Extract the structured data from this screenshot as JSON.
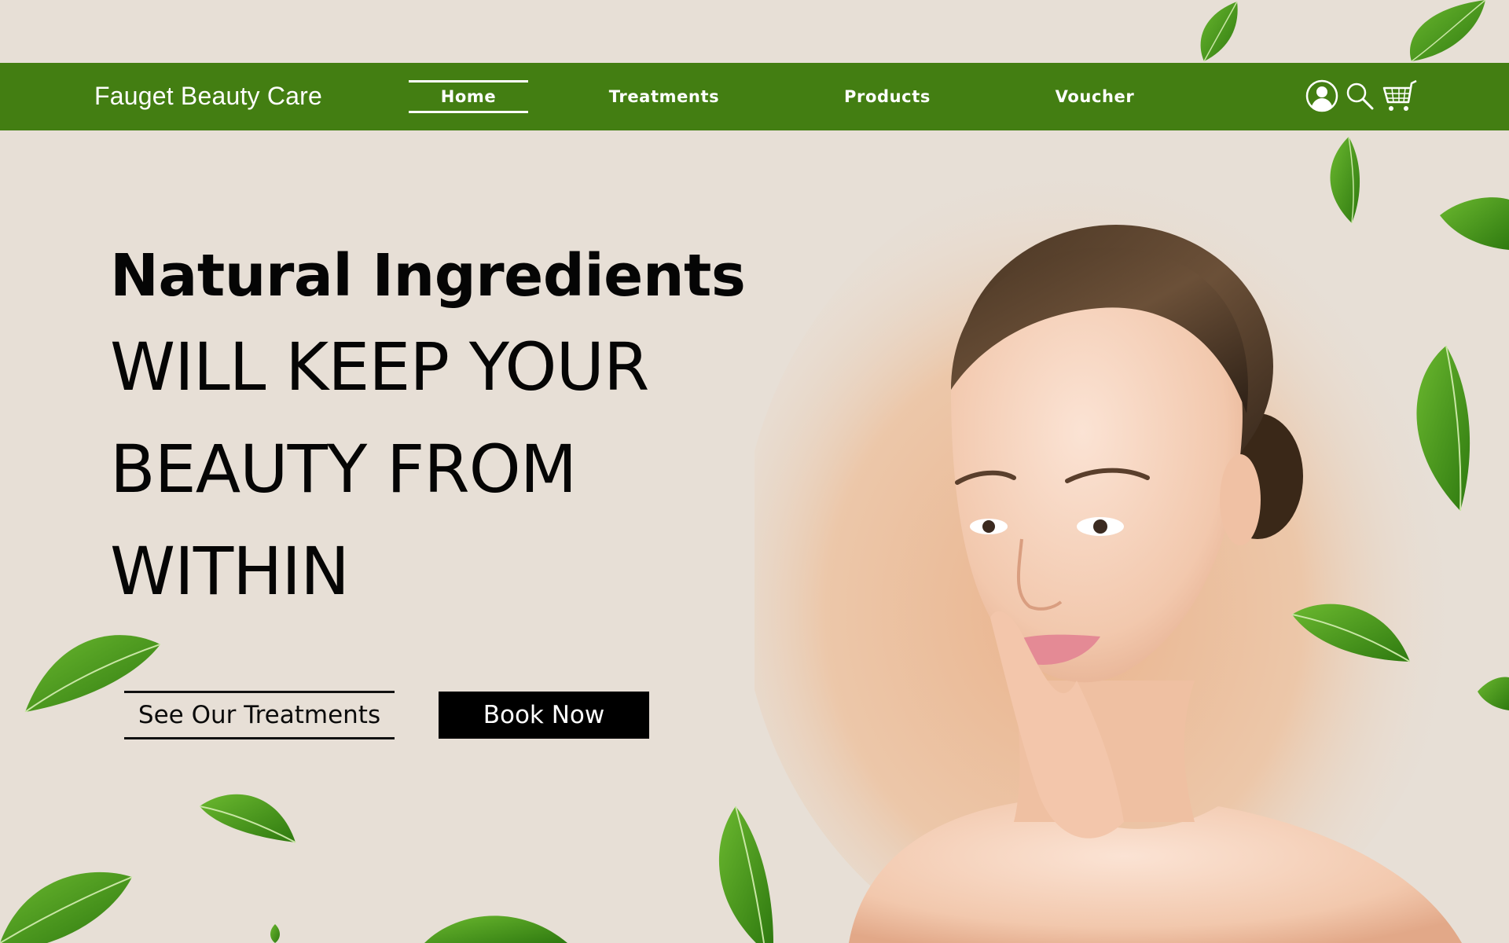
{
  "header": {
    "brand": "Fauget Beauty Care",
    "nav": [
      {
        "label": "Home",
        "active": true
      },
      {
        "label": "Treatments",
        "active": false
      },
      {
        "label": "Products",
        "active": false
      },
      {
        "label": "Voucher",
        "active": false
      }
    ],
    "icons": [
      "account-icon",
      "search-icon",
      "cart-icon"
    ]
  },
  "hero": {
    "heading": "Natural Ingredients",
    "lines": [
      "WILL KEEP YOUR",
      "BEAUTY FROM",
      "WITHIN"
    ],
    "secondary_button": "See Our Treatments",
    "primary_button": "Book Now"
  },
  "colors": {
    "background": "#e7dfd6",
    "nav_bar": "#437e12",
    "leaf": "#4f9a1f",
    "text": "#050505",
    "button_primary": "#000000"
  }
}
